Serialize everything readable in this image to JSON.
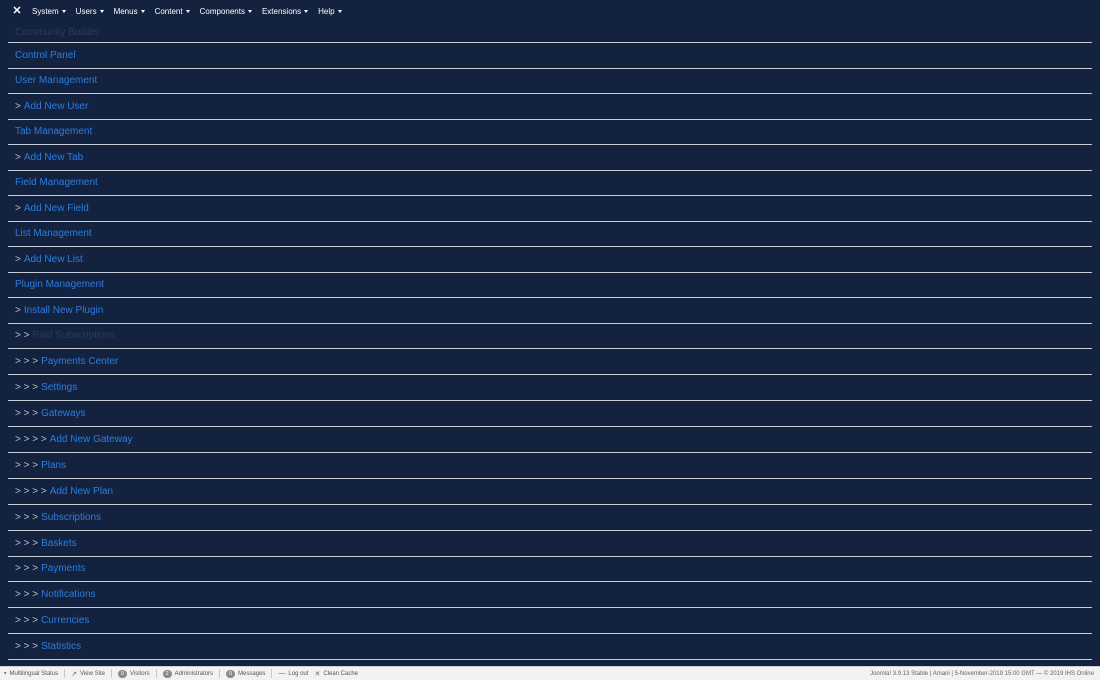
{
  "topbar": {
    "logo_icon": "joomla-icon",
    "menus": [
      "System",
      "Users",
      "Menus",
      "Content",
      "Components",
      "Extensions",
      "Help"
    ]
  },
  "menu_list": {
    "items": [
      {
        "prefix": "",
        "label": "Community Builder",
        "muted": true
      },
      {
        "prefix": "",
        "label": "Control Panel"
      },
      {
        "prefix": "",
        "label": "User Management"
      },
      {
        "prefix": ">",
        "label": "Add New User"
      },
      {
        "prefix": "",
        "label": "Tab Management"
      },
      {
        "prefix": ">",
        "label": "Add New Tab"
      },
      {
        "prefix": "",
        "label": "Field Management"
      },
      {
        "prefix": ">",
        "label": "Add New Field"
      },
      {
        "prefix": "",
        "label": "List Management"
      },
      {
        "prefix": ">",
        "label": "Add New List"
      },
      {
        "prefix": "",
        "label": "Plugin Management"
      },
      {
        "prefix": ">",
        "label": "Install New Plugin"
      },
      {
        "prefix": "> >",
        "label": "Paid Subscriptions",
        "muted": true
      },
      {
        "prefix": "> > >",
        "label": "Payments Center"
      },
      {
        "prefix": "> > >",
        "label": "Settings"
      },
      {
        "prefix": "> > >",
        "label": "Gateways"
      },
      {
        "prefix": "> > > >",
        "label": "Add New Gateway"
      },
      {
        "prefix": "> > >",
        "label": "Plans"
      },
      {
        "prefix": "> > > >",
        "label": "Add New Plan"
      },
      {
        "prefix": "> > >",
        "label": "Subscriptions"
      },
      {
        "prefix": "> > >",
        "label": "Baskets"
      },
      {
        "prefix": "> > >",
        "label": "Payments"
      },
      {
        "prefix": "> > >",
        "label": "Notifications"
      },
      {
        "prefix": "> > >",
        "label": "Currencies"
      },
      {
        "prefix": "> > >",
        "label": "Statistics"
      }
    ]
  },
  "footer": {
    "multilingual": "Multilingual Status",
    "view_site": "View Site",
    "visitors_count": "0",
    "visitors": "Visitors",
    "admins_count": "2",
    "admins": "Administrators",
    "messages_count": "0",
    "messages": "Messages",
    "logout": "Log out",
    "clean_cache": "Clean Cache",
    "version": "Joomla! 3.9.13 Stable | Amani | 5-November-2019 15:00 GMT",
    "copyright": "— © 2019 IHS Online"
  }
}
